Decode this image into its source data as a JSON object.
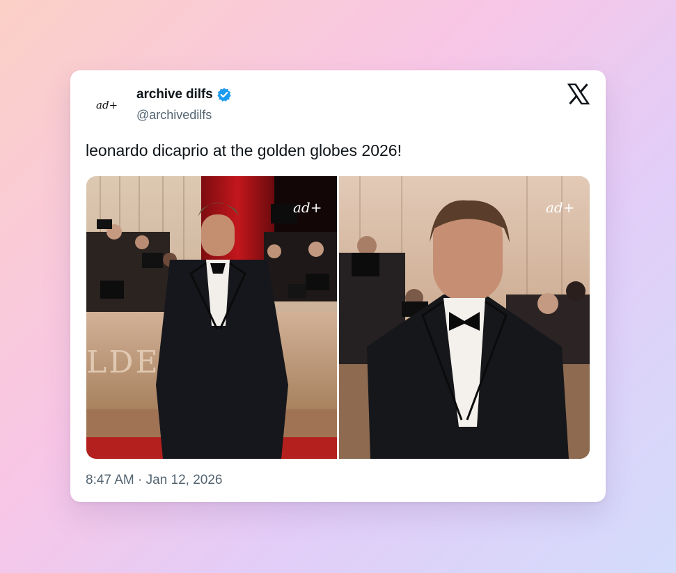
{
  "tweet": {
    "display_name": "archive dilfs",
    "handle": "@archivedilfs",
    "avatar_text": "ad+",
    "verified_icon": "verified-badge-icon",
    "text": "leonardo dicaprio at the golden globes 2026!",
    "time": "8:47 AM",
    "separator": "·",
    "date": "Jan 12, 2026",
    "platform_logo": "x-logo-icon"
  },
  "media": {
    "photos": [
      {
        "alt": "red carpet full-length photo",
        "backdrop_text": "LDEN   ES",
        "watermark": "ad+"
      },
      {
        "alt": "close-up red carpet photo",
        "watermark": "ad+"
      }
    ]
  },
  "colors": {
    "verified": "#1d9bf0",
    "name": "#0f1419",
    "secondary": "#536471",
    "card": "#ffffff"
  }
}
